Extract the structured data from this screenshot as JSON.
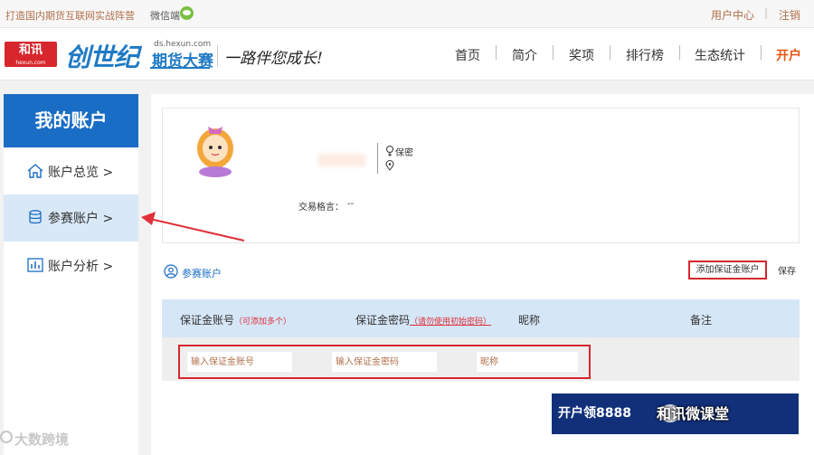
{
  "topbar": {
    "slogan": "打造国内期货互联网实战阵营",
    "wechat_label": "微信端",
    "user_center": "用户中心",
    "separator": "|",
    "logout": "注销"
  },
  "header": {
    "hexun_logo": "和讯",
    "hexun_logo_small": "hexun.com",
    "brand_main": "创世纪",
    "brand_domain": "ds.hexun.com",
    "brand_sub": "期货大赛",
    "motto": "一路伴您成长!",
    "nav": [
      "首页",
      "简介",
      "奖项",
      "排行榜",
      "生态统计",
      "开户"
    ]
  },
  "sidebar": {
    "title": "我的账户",
    "items": [
      {
        "label": "账户总览 >",
        "icon": "home-icon",
        "active": false
      },
      {
        "label": "参赛账户 >",
        "icon": "database-icon",
        "active": true
      },
      {
        "label": "账户分析 >",
        "icon": "chart-icon",
        "active": false
      }
    ]
  },
  "profile": {
    "privacy": "保密",
    "motto_label": "交易格言：",
    "motto_value": "--"
  },
  "account_section": {
    "title": "参赛账户",
    "add_button": "添加保证金账户",
    "save_button": "保存"
  },
  "table": {
    "col1": "保证金账号",
    "col1_note": "（可添加多个）",
    "col2": "保证金密码",
    "col2_note": "（请勿使用初始密码）",
    "col3": "昵称",
    "col4": "备注"
  },
  "inputs": {
    "account_placeholder": "输入保证金账号",
    "password_placeholder": "输入保证金密码",
    "nickname_placeholder": "昵称"
  },
  "promo": {
    "text": "开户领8888",
    "watermark": "和讯微课堂"
  },
  "watermark": "大数跨境",
  "colors": {
    "brand_blue": "#1a6dc4",
    "highlight_red": "#d7272d",
    "nav_open": "#e8550d",
    "table_header": "#d5e6f6"
  }
}
